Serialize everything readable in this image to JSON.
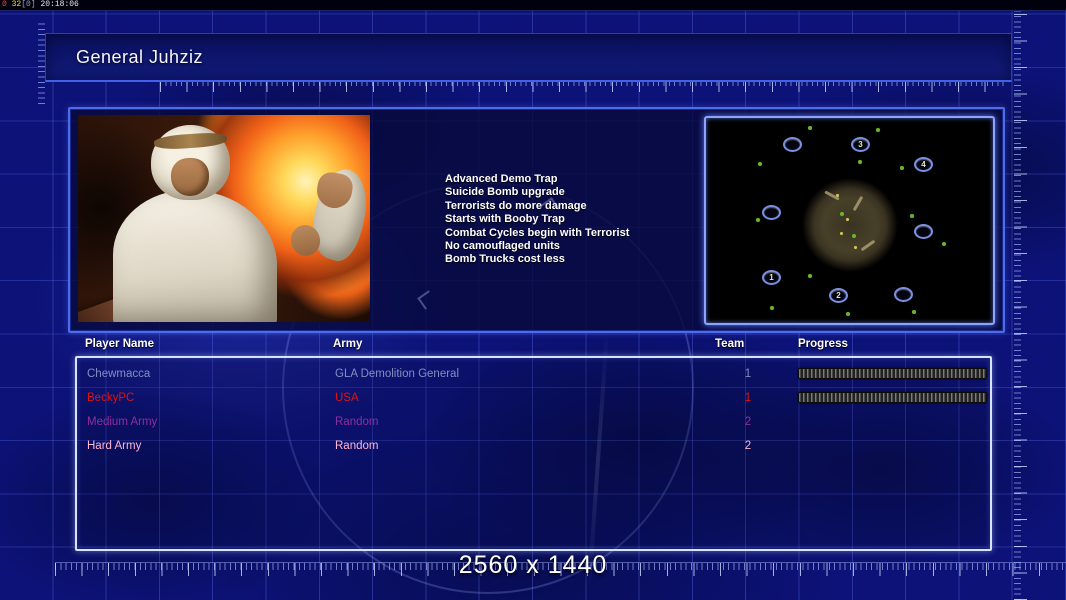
{
  "theme": {
    "background": "#0c1277",
    "grid_line": "#566aee",
    "frame_blue": "#4f6ce8",
    "map_frame_glow": "#8ca4ff",
    "table_frame": "#d9e2ff",
    "map_sand": "#c79f58",
    "fire_orange": "#ff9d2a"
  },
  "debug_overlay": {
    "fps": "0",
    "counter": "32",
    "bracket": "[0]",
    "clock": "20:18:06"
  },
  "title_bar": {
    "title": "General Juhziz"
  },
  "general_panel": {
    "abilities": [
      "Advanced Demo Trap",
      "Suicide Bomb upgrade",
      "Terrorists do more damage",
      "Starts with Booby Trap",
      "Combat Cycles begin with Terrorist",
      "No camouflaged units",
      "Bomb Trucks cost less"
    ]
  },
  "map_preview": {
    "markers": [
      {
        "label": ""
      },
      {
        "label": "3"
      },
      {
        "label": "4"
      },
      {
        "label": ""
      },
      {
        "label": ""
      },
      {
        "label": "1"
      },
      {
        "label": "2"
      },
      {
        "label": ""
      }
    ]
  },
  "player_table": {
    "columns": [
      "Player Name",
      "Army",
      "Team",
      "Progress"
    ],
    "rows": [
      {
        "player": "Chewmacca",
        "army": "GLA Demolition General",
        "team": "1",
        "color": "#8090c2",
        "progress": 2
      },
      {
        "player": "BeckyPC",
        "army": "USA",
        "team": "1",
        "color": "#e01212",
        "progress": 0
      },
      {
        "player": "Medium Army",
        "army": "Random",
        "team": "2",
        "color": "#8e2f9e",
        "progress": null
      },
      {
        "player": "Hard Army",
        "army": "Random",
        "team": "2",
        "color": "#ffb7d2",
        "progress": null
      }
    ]
  },
  "footer": {
    "resolution": "2560 x 1440"
  }
}
